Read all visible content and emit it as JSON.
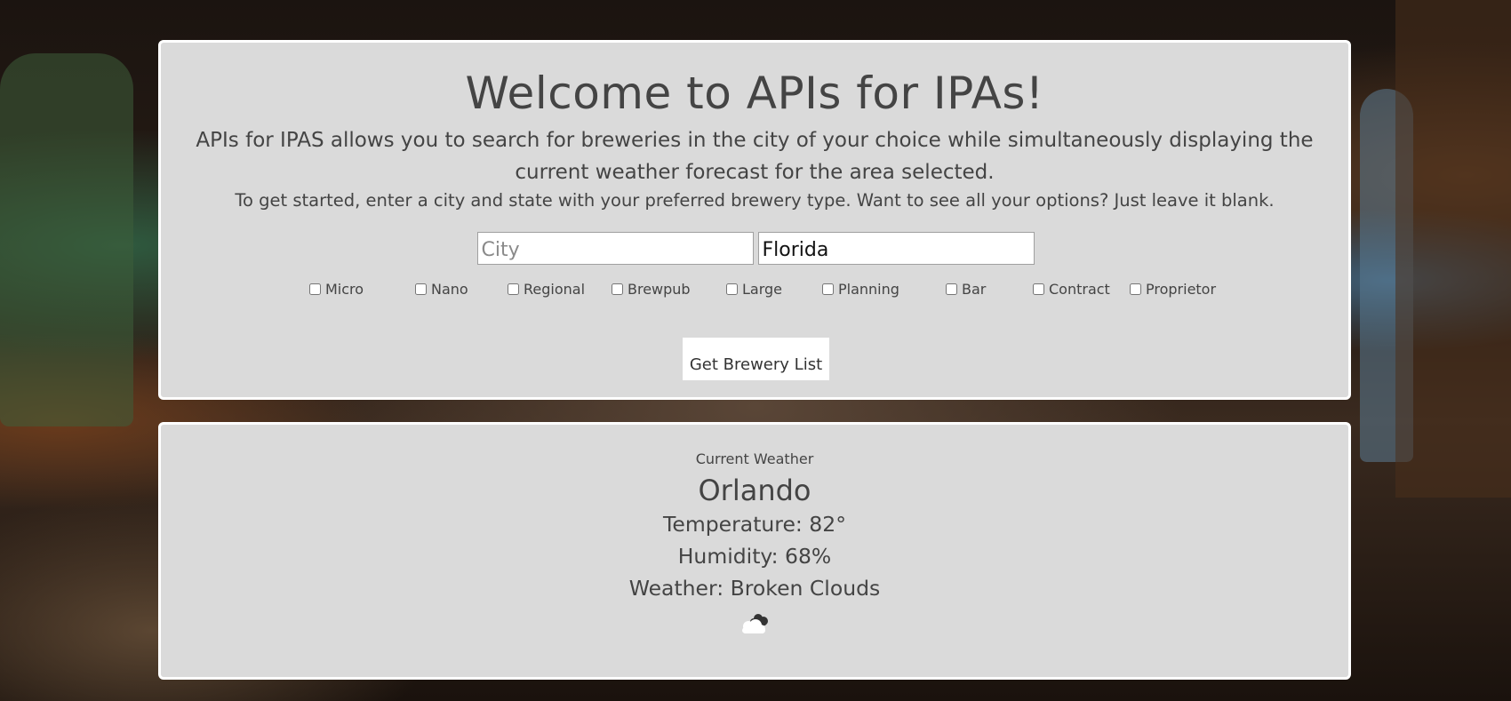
{
  "search": {
    "title": "Welcome to APIs for IPAs!",
    "description": "APIs for IPAS allows you to search for breweries in the city of your choice while simultaneously displaying the current weather forecast for the area selected.",
    "instructions": "To get started, enter a city and state with your preferred brewery type. Want to see all your options? Just leave it blank.",
    "city_placeholder": "City",
    "city_value": "",
    "state_value": "Florida",
    "brewery_types": [
      {
        "label": "Micro",
        "checked": false
      },
      {
        "label": "Nano",
        "checked": false
      },
      {
        "label": "Regional",
        "checked": false
      },
      {
        "label": "Brewpub",
        "checked": false
      },
      {
        "label": "Large",
        "checked": false
      },
      {
        "label": "Planning",
        "checked": false
      },
      {
        "label": "Bar",
        "checked": false
      },
      {
        "label": "Contract",
        "checked": false
      },
      {
        "label": "Proprietor",
        "checked": false
      }
    ],
    "submit_label": "Get Brewery List"
  },
  "weather": {
    "label": "Current Weather",
    "city": "Orlando",
    "temperature": "Temperature: 82°",
    "humidity": "Humidity: 68%",
    "conditions": "Weather: Broken Clouds",
    "icon": "broken-clouds-icon"
  },
  "colors": {
    "panel_background": "#dadada",
    "panel_border": "#ffffff",
    "text": "#444444"
  }
}
